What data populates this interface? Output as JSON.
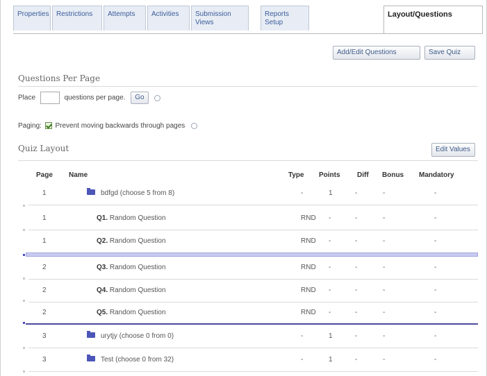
{
  "tabs": [
    {
      "label": "Properties"
    },
    {
      "label": "Restrictions"
    },
    {
      "label": "Attempts"
    },
    {
      "label": "Activities"
    },
    {
      "label": "Submission Views"
    },
    {
      "label": "Reports Setup"
    },
    {
      "label": "Layout/Questions"
    }
  ],
  "toolbar": {
    "add_edit_label": "Add/Edit Questions",
    "save_label": "Save Quiz"
  },
  "questions_per_page": {
    "title": "Questions Per Page",
    "place_label": "Place",
    "per_page_label": "questions per page.",
    "go_label": "Go",
    "value": ""
  },
  "paging": {
    "label": "Paging:",
    "checkbox_label": "Prevent moving backwards through pages",
    "checked": true
  },
  "layout": {
    "title": "Quiz Layout",
    "edit_values_label": "Edit Values"
  },
  "table": {
    "headers": {
      "page": "Page",
      "name": "Name",
      "type": "Type",
      "points": "Points",
      "diff": "Diff",
      "bonus": "Bonus",
      "mandatory": "Mandatory"
    },
    "rows": [
      {
        "page": "1",
        "folder": true,
        "num": "",
        "name": "bdfgd (choose 5 from 8)",
        "type": "-",
        "points": "1",
        "diff": "-",
        "bonus": "-",
        "mandatory": "-"
      },
      {
        "page": "1",
        "folder": false,
        "num": "Q1.",
        "name": "Random Question",
        "type": "RND",
        "points": "-",
        "diff": "-",
        "bonus": "-",
        "mandatory": "-"
      },
      {
        "page": "1",
        "folder": false,
        "num": "Q2.",
        "name": "Random Question",
        "type": "RND",
        "points": "-",
        "diff": "-",
        "bonus": "-",
        "mandatory": "-"
      },
      {
        "page": "2",
        "folder": false,
        "num": "Q3.",
        "name": "Random Question",
        "type": "RND",
        "points": "-",
        "diff": "-",
        "bonus": "-",
        "mandatory": "-"
      },
      {
        "page": "2",
        "folder": false,
        "num": "Q4.",
        "name": "Random Question",
        "type": "RND",
        "points": "-",
        "diff": "-",
        "bonus": "-",
        "mandatory": "-"
      },
      {
        "page": "2",
        "folder": false,
        "num": "Q5.",
        "name": "Random Question",
        "type": "RND",
        "points": "-",
        "diff": "-",
        "bonus": "-",
        "mandatory": "-"
      },
      {
        "page": "3",
        "folder": true,
        "num": "",
        "name": "urytjy (choose 0 from 0)",
        "type": "-",
        "points": "1",
        "diff": "-",
        "bonus": "-",
        "mandatory": "-"
      },
      {
        "page": "3",
        "folder": true,
        "num": "",
        "name": "Test (choose 0 from 32)",
        "type": "-",
        "points": "1",
        "diff": "-",
        "bonus": "-",
        "mandatory": "-"
      }
    ]
  },
  "colors": {
    "accent": "#3b5c99",
    "folder": "#4c55b8",
    "drop_zone": "#c9cbf0"
  }
}
